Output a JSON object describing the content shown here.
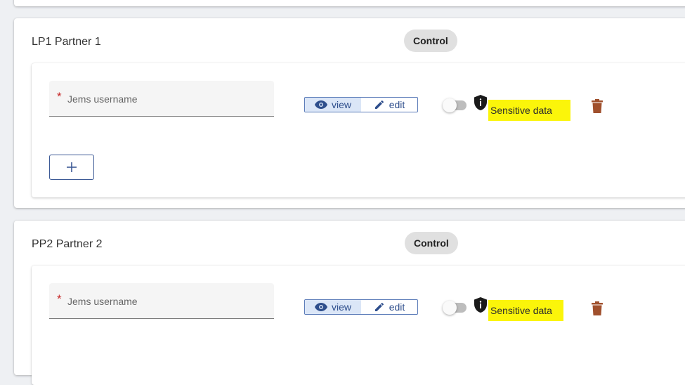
{
  "partners": [
    {
      "title": "LP1 Partner 1",
      "badge": "Control",
      "username_placeholder": "Jems username",
      "required_mark": "*",
      "view_label": "view",
      "edit_label": "edit",
      "sensitive_label": "Sensitive data"
    },
    {
      "title": "PP2 Partner 2",
      "badge": "Control",
      "username_placeholder": "Jems username",
      "required_mark": "*",
      "view_label": "view",
      "edit_label": "edit",
      "sensitive_label": "Sensitive data"
    }
  ],
  "colors": {
    "highlight": "#fbf50a",
    "delete": "#a0502d",
    "accent": "#2e4e8c",
    "required": "#c62828"
  },
  "icons": [
    "eye-icon",
    "pencil-icon",
    "shield-info-icon",
    "trash-icon",
    "plus-icon"
  ]
}
